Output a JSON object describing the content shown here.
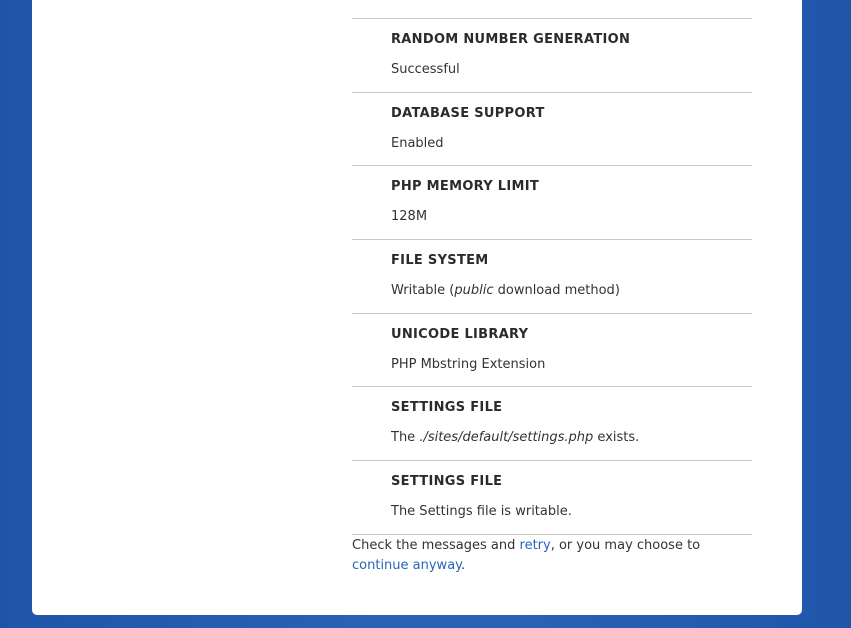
{
  "requirements": [
    {
      "title": "Random Number Generation",
      "value": "Successful"
    },
    {
      "title": "Database Support",
      "value": "Enabled"
    },
    {
      "title": "PHP Memory Limit",
      "value": "128M"
    },
    {
      "title": "File System",
      "value_pre": "Writable (",
      "value_em": "public",
      "value_post": " download method)"
    },
    {
      "title": "Unicode Library",
      "value": "PHP Mbstring Extension"
    },
    {
      "title": "Settings File",
      "value_pre": "The ",
      "value_em": "./sites/default/settings.php",
      "value_post": " exists."
    },
    {
      "title": "Settings File",
      "value": "The Settings file is writable."
    }
  ],
  "footer": {
    "text_1": "Check the messages and ",
    "retry_link": "retry",
    "text_2": ", or you may choose to",
    "continue_link": "continue anyway",
    "text_3": "."
  }
}
